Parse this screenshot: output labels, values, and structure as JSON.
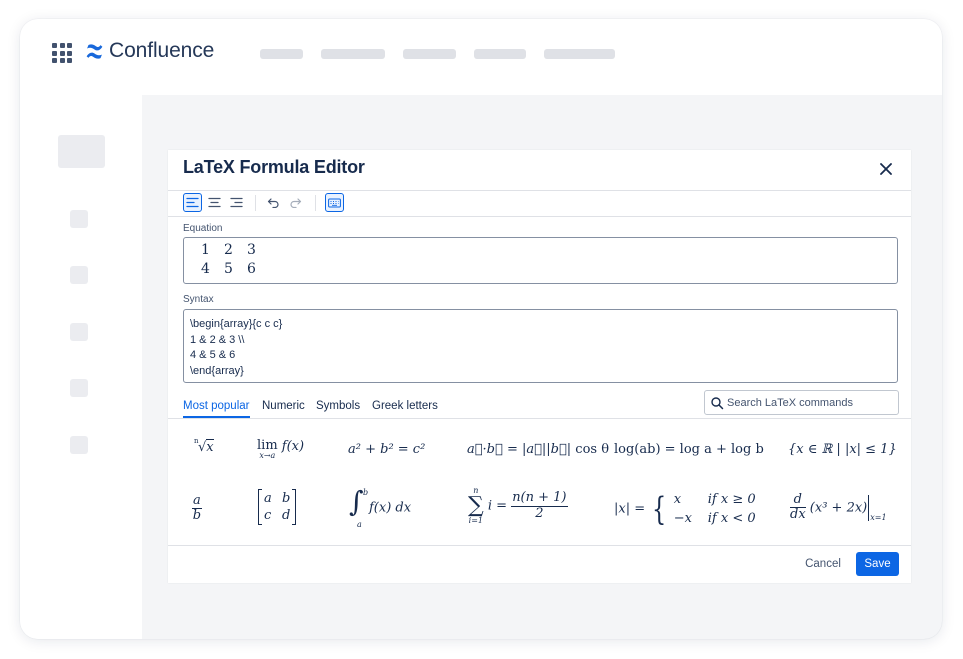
{
  "app": {
    "name": "Confluence",
    "brand_color": "#1868db",
    "app_switcher_icon": "grid-icon",
    "logo_icon": "confluence-logo-icon"
  },
  "modal": {
    "title": "LaTeX Formula Editor",
    "close_icon": "close-icon",
    "toolbar": [
      "align-left-icon",
      "align-center-icon",
      "align-right-icon",
      "undo-icon",
      "redo-icon",
      "keyboard-icon"
    ],
    "equation": {
      "label": "Equation",
      "rows": [
        [
          "1",
          "2",
          "3"
        ],
        [
          "4",
          "5",
          "6"
        ]
      ]
    },
    "syntax": {
      "label": "Syntax",
      "lines": [
        "\\begin{array}{c c c}",
        "1 & 2 & 3 \\\\",
        "4 & 5 & 6",
        "\\end{array}"
      ]
    },
    "tabs": [
      "Most popular",
      "Numeric",
      "Symbols",
      "Greek letters"
    ],
    "active_tab": "Most popular",
    "search": {
      "placeholder": "Search LaTeX commands",
      "icon": "search-icon"
    },
    "symbols": {
      "nthroot": {
        "index": "n",
        "radicand": "x"
      },
      "limit": {
        "op": "lim",
        "sub": "x→a",
        "body": "f(x)"
      },
      "pythagoras": {
        "text": "a² + b² = c²"
      },
      "dot_product": {
        "lhs": "a⃗·b⃗ = ",
        "mid": "|a⃗||b⃗|",
        "rhs": " cos θ"
      },
      "log": {
        "text": "log(ab) = log a + log b"
      },
      "set": {
        "text": "{x ∈ ℝ | |x| ≤ 1}"
      },
      "fraction": {
        "num": "a",
        "den": "b"
      },
      "matrix": {
        "r1c1": "a",
        "r1c2": "b",
        "r2c1": "c",
        "r2c2": "d"
      },
      "integral": {
        "lower": "a",
        "upper": "b",
        "body": "f(x) dx"
      },
      "sum": {
        "upper": "n",
        "lower": "i=1",
        "var": "i =",
        "num": "n(n + 1)",
        "den": "2"
      },
      "abs_cases": {
        "lhs": "|x| =",
        "c1": "x",
        "cond1": "if x ≥ 0",
        "c2": "−x",
        "cond2": "if x < 0"
      },
      "derivative": {
        "num": "d",
        "den": "dx",
        "body": "(x³ + 2x)",
        "eval": "x=1"
      }
    },
    "actions": {
      "cancel": "Cancel",
      "save": "Save"
    }
  }
}
